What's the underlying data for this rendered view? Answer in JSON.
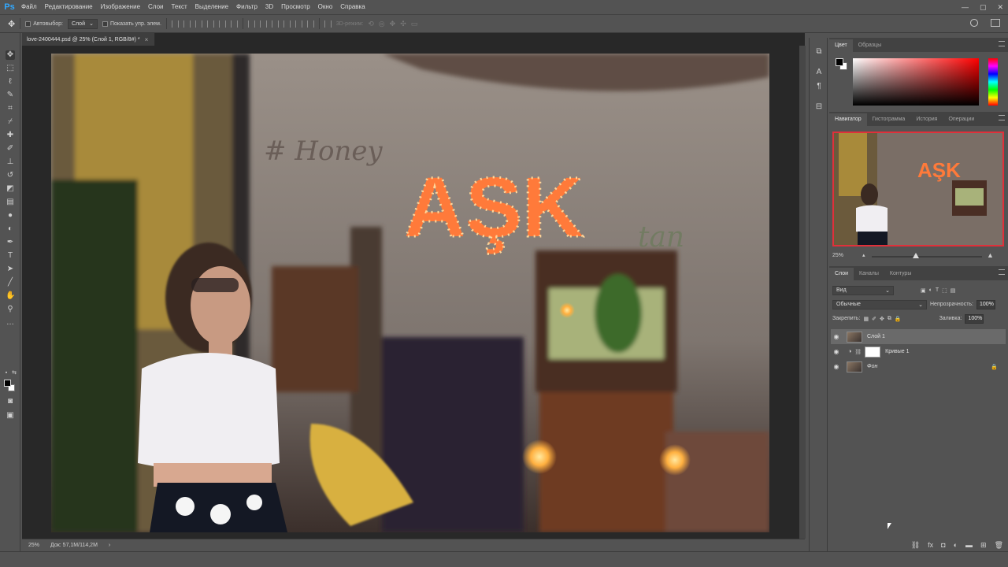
{
  "menu": {
    "logo": "Ps",
    "items": [
      "Файл",
      "Редактирование",
      "Изображение",
      "Слои",
      "Текст",
      "Выделение",
      "Фильтр",
      "3D",
      "Просмотр",
      "Окно",
      "Справка"
    ],
    "window_controls": [
      "—",
      "▢",
      "✕"
    ]
  },
  "options": {
    "autoselect_label": "Автовыбор:",
    "autoselect_value": "Слой",
    "show_transform_label": "Показать упр. элем.",
    "mode_3d_label": "3D-режим:"
  },
  "document": {
    "tab_title": "love-2400444.psd @ 25% (Слой 1, RGB/8#) *",
    "tab_close": "×",
    "canvas": {
      "sign_text": "AŞK",
      "graffiti_text": "# Honey",
      "script_text": "tan"
    }
  },
  "status": {
    "zoom": "25%",
    "doc_size": "Док: 57,1M/114,2M",
    "arrow": "›"
  },
  "color_panel": {
    "tabs": [
      "Цвет",
      "Образцы"
    ],
    "fg": "#000000",
    "bg": "#ffffff"
  },
  "navigator_panel": {
    "tabs": [
      "Навигатор",
      "Гистограмма",
      "История",
      "Операции"
    ],
    "zoom": "25%",
    "zoom_level": 0.25
  },
  "layers_panel": {
    "tabs": [
      "Слои",
      "Каналы",
      "Контуры"
    ],
    "filter_label": "Вид",
    "blend_mode": "Обычные",
    "opacity_label": "Непрозрачность:",
    "opacity_value": "100%",
    "lock_label": "Закрепить:",
    "fill_label": "Заливка:",
    "fill_value": "100%",
    "layers": [
      {
        "name": "Слой 1",
        "selected": true,
        "type": "pixel"
      },
      {
        "name": "Кривые 1",
        "selected": false,
        "type": "adjustment"
      },
      {
        "name": "Фон",
        "selected": false,
        "type": "background",
        "locked": true
      }
    ]
  },
  "colors": {
    "accent": "#31a8ff",
    "nav_frame": "#e0303a",
    "panel_bg": "#535353"
  }
}
